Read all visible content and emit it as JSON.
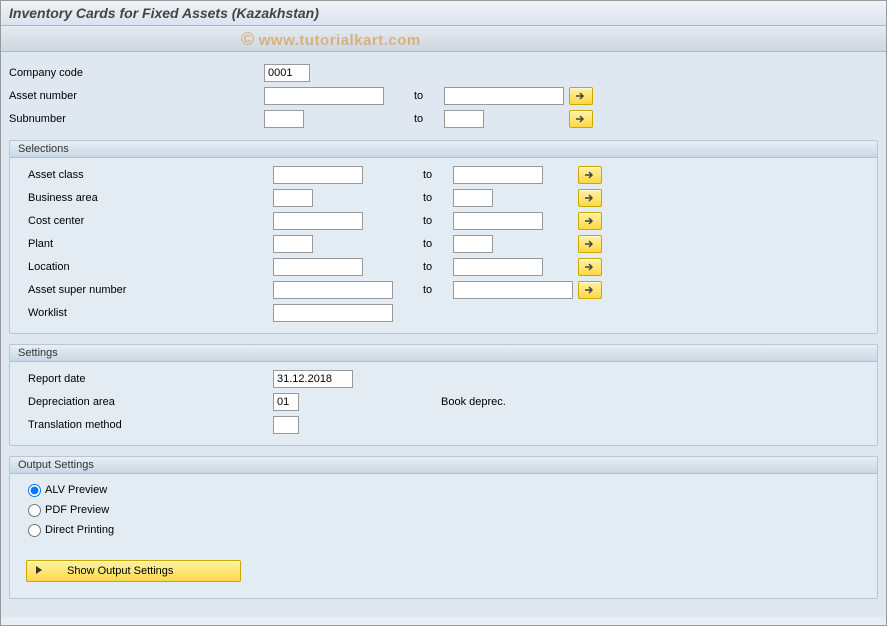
{
  "title": "Inventory Cards for Fixed Assets (Kazakhstan)",
  "watermark": "www.tutorialkart.com",
  "top": {
    "company_code_label": "Company code",
    "company_code_value": "0001",
    "asset_number_label": "Asset number",
    "asset_number_from": "",
    "asset_number_to": "",
    "subnumber_label": "Subnumber",
    "subnumber_from": "",
    "subnumber_to": "",
    "to_label": "to"
  },
  "selections": {
    "header": "Selections",
    "to_label": "to",
    "rows": [
      {
        "label": "Asset class",
        "from": "",
        "to": "",
        "from_w": "w-med",
        "to_w": "w-med",
        "multi": true
      },
      {
        "label": "Business area",
        "from": "",
        "to": "",
        "from_w": "w-short",
        "to_w": "w-short",
        "multi": true
      },
      {
        "label": "Cost center",
        "from": "",
        "to": "",
        "from_w": "w-med",
        "to_w": "w-med",
        "multi": true
      },
      {
        "label": "Plant",
        "from": "",
        "to": "",
        "from_w": "w-short",
        "to_w": "w-short",
        "multi": true
      },
      {
        "label": "Location",
        "from": "",
        "to": "",
        "from_w": "w-med",
        "to_w": "w-med",
        "multi": true
      },
      {
        "label": "Asset super number",
        "from": "",
        "to": "",
        "from_w": "w-long",
        "to_w": "w-long",
        "multi": true
      },
      {
        "label": "Worklist",
        "from": "",
        "to": "",
        "from_w": "w-long",
        "to_w": "",
        "single": true
      }
    ]
  },
  "settings": {
    "header": "Settings",
    "report_date_label": "Report date",
    "report_date_value": "31.12.2018",
    "depr_area_label": "Depreciation area",
    "depr_area_value": "01",
    "depr_area_text": "Book deprec.",
    "trans_method_label": "Translation method",
    "trans_method_value": ""
  },
  "output": {
    "header": "Output Settings",
    "options": [
      "ALV Preview",
      "PDF Preview",
      "Direct Printing"
    ],
    "selected": 0,
    "show_button_label": "Show Output Settings"
  }
}
